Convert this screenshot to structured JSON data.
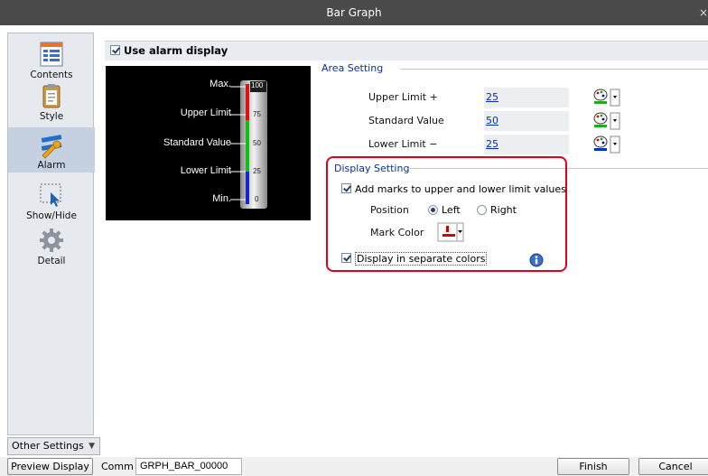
{
  "window": {
    "title": "Bar Graph",
    "close": "×"
  },
  "sidebar": {
    "items": [
      {
        "label": "Contents"
      },
      {
        "label": "Style"
      },
      {
        "label": "Alarm"
      },
      {
        "label": "Show/Hide"
      },
      {
        "label": "Detail"
      }
    ],
    "other_settings": "Other Settings"
  },
  "header": {
    "label": "Use alarm display"
  },
  "preview": {
    "labels": [
      "Max.",
      "Upper Limit",
      "Standard Value",
      "Lower Limit",
      "Min."
    ],
    "ticks": [
      "100",
      "75",
      "50",
      "25",
      "0"
    ]
  },
  "area_setting": {
    "title": "Area Setting",
    "rows": [
      {
        "label": "Upper Limit +",
        "value": "25",
        "color": "#22aa22"
      },
      {
        "label": "Standard Value",
        "value": "50",
        "color": "#22aa22"
      },
      {
        "label": "Lower Limit −",
        "value": "25",
        "color": "#0033cc"
      }
    ]
  },
  "display_setting": {
    "title": "Display Setting",
    "add_marks": "Add marks to upper and lower limit values",
    "position_label": "Position",
    "position_options": [
      "Left",
      "Right"
    ],
    "position_selected": "Left",
    "mark_color_label": "Mark Color",
    "mark_color": "#d00000",
    "separate_colors": "Display in separate colors"
  },
  "footer": {
    "preview_button": "Preview Display",
    "comm_label": "Comm",
    "comm_value": "GRPH_BAR_00000",
    "finish": "Finish",
    "cancel": "Cancel"
  }
}
